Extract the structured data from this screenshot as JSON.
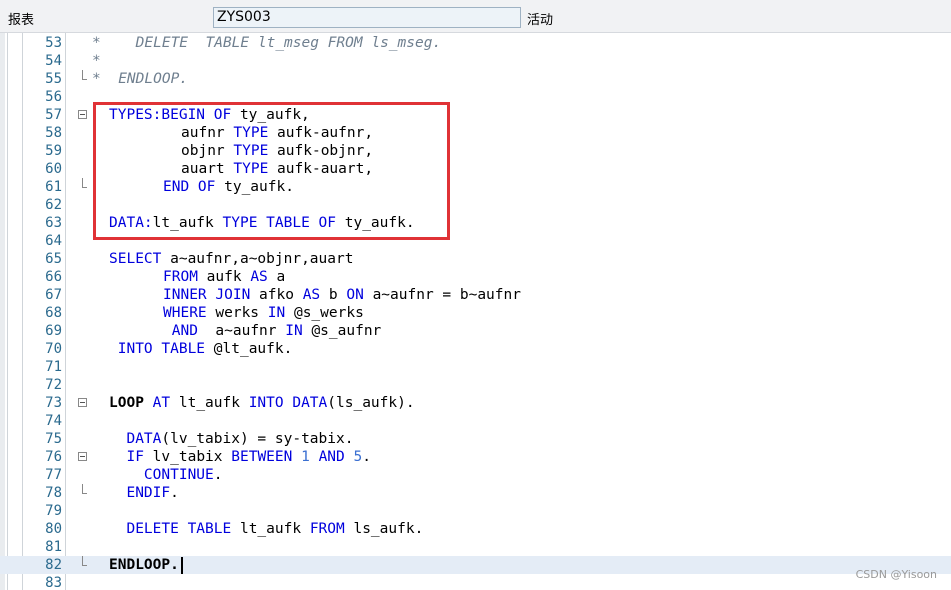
{
  "toolbar": {
    "report_label": "报表",
    "program_name": "ZYS003",
    "status_label": "活动"
  },
  "editor": {
    "lines": [
      {
        "n": "53",
        "type": "comment",
        "text": "*    DELETE  TABLE lt_mseg FROM ls_mseg."
      },
      {
        "n": "54",
        "type": "comment",
        "text": "*"
      },
      {
        "n": "55",
        "type": "comment",
        "text": "*  ENDLOOP."
      },
      {
        "n": "56",
        "type": "blank",
        "text": ""
      },
      {
        "n": "57",
        "type": "code",
        "text": "TYPES:BEGIN OF ty_aufk,"
      },
      {
        "n": "58",
        "type": "code",
        "text": "        aufnr TYPE aufk-aufnr,"
      },
      {
        "n": "59",
        "type": "code",
        "text": "        objnr TYPE aufk-objnr,"
      },
      {
        "n": "60",
        "type": "code",
        "text": "        auart TYPE aufk-auart,"
      },
      {
        "n": "61",
        "type": "code",
        "text": "      END OF ty_aufk."
      },
      {
        "n": "62",
        "type": "blank",
        "text": ""
      },
      {
        "n": "63",
        "type": "code",
        "text": "DATA:lt_aufk TYPE TABLE OF ty_aufk."
      },
      {
        "n": "64",
        "type": "blank",
        "text": ""
      },
      {
        "n": "65",
        "type": "code",
        "text": "SELECT a~aufnr,a~objnr,auart"
      },
      {
        "n": "66",
        "type": "code",
        "text": "      FROM aufk AS a"
      },
      {
        "n": "67",
        "type": "code",
        "text": "      INNER JOIN afko AS b ON a~aufnr = b~aufnr"
      },
      {
        "n": "68",
        "type": "code",
        "text": "      WHERE werks IN @s_werks"
      },
      {
        "n": "69",
        "type": "code",
        "text": "       AND  a~aufnr IN @s_aufnr"
      },
      {
        "n": "70",
        "type": "code",
        "text": " INTO TABLE @lt_aufk."
      },
      {
        "n": "71",
        "type": "blank",
        "text": ""
      },
      {
        "n": "72",
        "type": "blank",
        "text": ""
      },
      {
        "n": "73",
        "type": "code",
        "text": "LOOP AT lt_aufk INTO DATA(ls_aufk)."
      },
      {
        "n": "74",
        "type": "blank",
        "text": ""
      },
      {
        "n": "75",
        "type": "code",
        "text": "  DATA(lv_tabix) = sy-tabix."
      },
      {
        "n": "76",
        "type": "code",
        "text": "  IF lv_tabix BETWEEN 1 AND 5."
      },
      {
        "n": "77",
        "type": "code",
        "text": "    CONTINUE."
      },
      {
        "n": "78",
        "type": "code",
        "text": "  ENDIF."
      },
      {
        "n": "79",
        "type": "blank",
        "text": ""
      },
      {
        "n": "80",
        "type": "code",
        "text": "  DELETE TABLE lt_aufk FROM ls_aufk."
      },
      {
        "n": "81",
        "type": "blank",
        "text": ""
      },
      {
        "n": "82",
        "type": "code",
        "text": "ENDLOOP."
      },
      {
        "n": "83",
        "type": "blank",
        "text": ""
      }
    ]
  },
  "watermark": "CSDN @Yisoon",
  "colors": {
    "keyword": "#0000dd",
    "comment": "#6f7f8f",
    "number": "#3a6fd1",
    "line_number": "#2b6a8e",
    "highlight_box": "#e03236",
    "current_line": "#e4ecf6"
  }
}
